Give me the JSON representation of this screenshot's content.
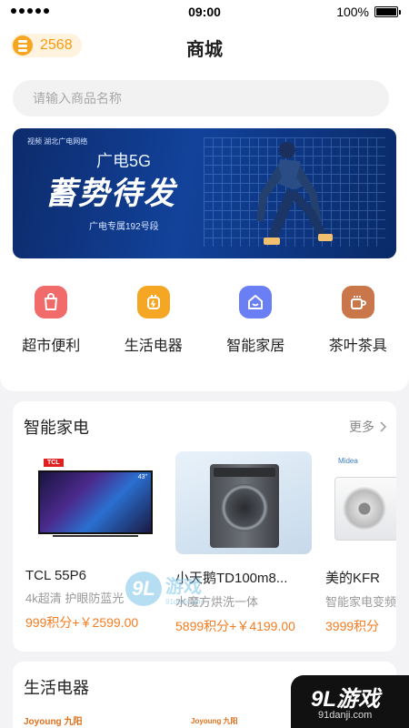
{
  "status_bar": {
    "time": "09:00",
    "battery": "100%"
  },
  "header": {
    "coin_count": "2568",
    "title": "商城"
  },
  "search": {
    "placeholder": "请输入商品名称"
  },
  "banner": {
    "brand": "视频 湖北广电网络",
    "line1": "广电5G",
    "headline": "蓄势待发",
    "sub": "广电专属192号段"
  },
  "categories": [
    {
      "label": "超市便利",
      "icon": "shopping-bag-icon",
      "color": "#f26b6b"
    },
    {
      "label": "生活电器",
      "icon": "plug-icon",
      "color": "#f5a623"
    },
    {
      "label": "智能家居",
      "icon": "smart-home-icon",
      "color": "#6b7ff5"
    },
    {
      "label": "茶叶茶具",
      "icon": "tea-cup-icon",
      "color": "#c8764a"
    }
  ],
  "section1": {
    "title": "智能家电",
    "more": "更多",
    "products": [
      {
        "name": "TCL 55P6",
        "desc": "4k超清 护眼防蓝光",
        "price": "999积分+￥2599.00",
        "brand_logo": "TCL",
        "screen_size": "43\""
      },
      {
        "name": "小天鹅TD100m8...",
        "desc": "水魔方烘洗一体",
        "price": "5899积分+￥4199.00"
      },
      {
        "name": "美的KFR",
        "desc": "智能家电变频",
        "price": "3999积分",
        "brand_logo": "Midea"
      }
    ]
  },
  "section2": {
    "title": "生活电器",
    "brand_a": "Joyoung 九阳",
    "brand_b": "Joyoung 九阳"
  },
  "watermark": {
    "badge": "9L",
    "text": "游戏",
    "url": "91danji.com"
  },
  "corner_badge": {
    "main": "9L游戏",
    "url": "91danji.com"
  }
}
